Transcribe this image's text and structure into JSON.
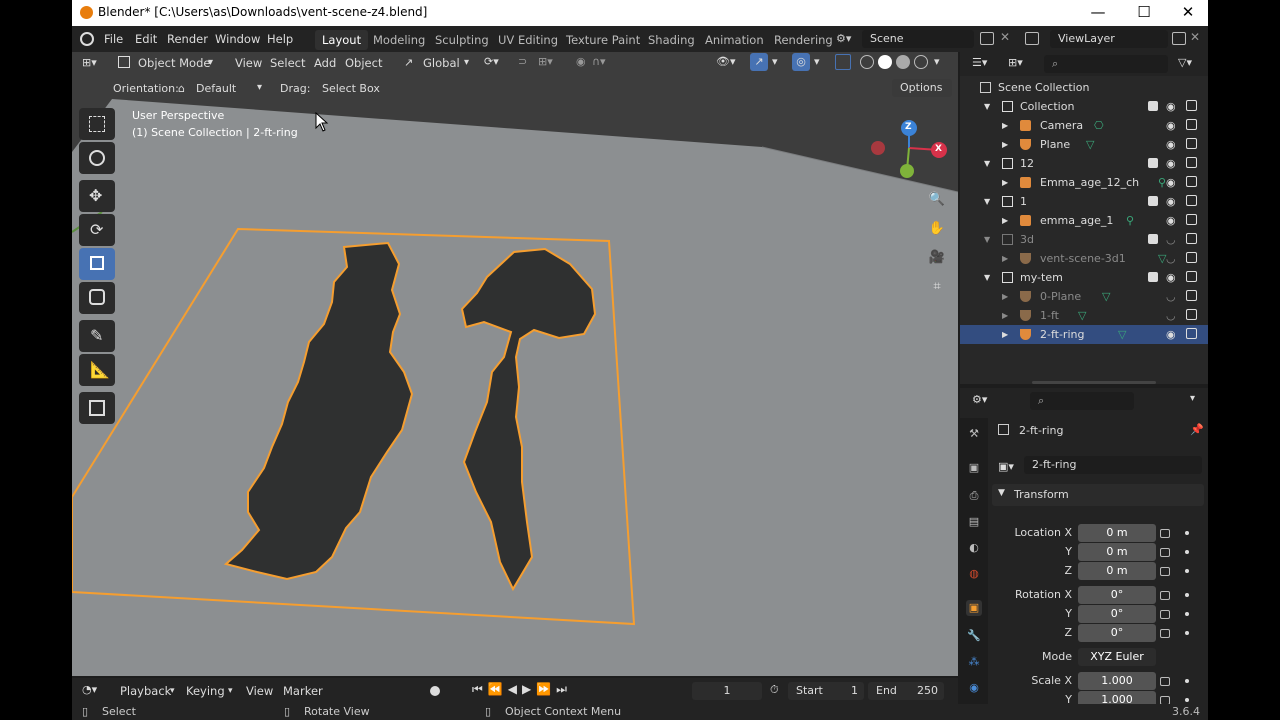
{
  "window": {
    "title": "Blender* [C:\\Users\\as\\Downloads\\vent-scene-z4.blend]",
    "minimize": "—",
    "maximize": "☐",
    "close": "✕"
  },
  "menus": [
    "File",
    "Edit",
    "Render",
    "Window",
    "Help"
  ],
  "workspaces": [
    "Layout",
    "Modeling",
    "Sculpting",
    "UV Editing",
    "Texture Paint",
    "Shading",
    "Animation",
    "Rendering"
  ],
  "scene": "Scene",
  "view_layer": "ViewLayer",
  "viewport_header": {
    "mode": "Object Mode",
    "view": "View",
    "select": "Select",
    "add": "Add",
    "object": "Object",
    "transform": "Global"
  },
  "tool_header": {
    "orientation_label": "Orientation:",
    "orientation": "Default",
    "drag_label": "Drag:",
    "drag": "Select Box",
    "options": "Options"
  },
  "viewport_info": {
    "line1": "User Perspective",
    "line2": "(1) Scene Collection | 2-ft-ring"
  },
  "gizmo": {
    "z": "Z",
    "x": "X"
  },
  "outliner": {
    "root": "Scene Collection",
    "rows": [
      {
        "label": "Collection",
        "kind": "collection",
        "depth": 0,
        "dim": false,
        "sel": false
      },
      {
        "label": "Camera",
        "kind": "camera",
        "depth": 1,
        "dim": false,
        "sel": false
      },
      {
        "label": "Plane",
        "kind": "mesh",
        "depth": 1,
        "dim": false,
        "sel": false
      },
      {
        "label": "12",
        "kind": "collection",
        "depth": 0,
        "dim": false,
        "sel": false
      },
      {
        "label": "Emma_age_12_ch",
        "kind": "armature",
        "depth": 1,
        "dim": false,
        "sel": false
      },
      {
        "label": "1",
        "kind": "collection",
        "depth": 0,
        "dim": false,
        "sel": false
      },
      {
        "label": "emma_age_1",
        "kind": "armature",
        "depth": 1,
        "dim": false,
        "sel": false
      },
      {
        "label": "3d",
        "kind": "collection",
        "depth": 0,
        "dim": true,
        "sel": false
      },
      {
        "label": "vent-scene-3d1",
        "kind": "mesh",
        "depth": 1,
        "dim": true,
        "sel": false
      },
      {
        "label": "my-tem",
        "kind": "collection",
        "depth": 0,
        "dim": false,
        "sel": false
      },
      {
        "label": "0-Plane",
        "kind": "mesh",
        "depth": 1,
        "dim": true,
        "sel": false
      },
      {
        "label": "1-ft",
        "kind": "mesh",
        "depth": 1,
        "dim": true,
        "sel": false
      },
      {
        "label": "2-ft-ring",
        "kind": "mesh",
        "depth": 1,
        "dim": false,
        "sel": true
      }
    ]
  },
  "properties": {
    "object_name": "2-ft-ring",
    "data_name": "2-ft-ring",
    "panel": "Transform",
    "rows": [
      {
        "label": "Location X",
        "value": "0 m"
      },
      {
        "label": "Y",
        "value": "0 m"
      },
      {
        "label": "Z",
        "value": "0 m"
      },
      {
        "label": "Rotation X",
        "value": "0°"
      },
      {
        "label": "Y",
        "value": "0°"
      },
      {
        "label": "Z",
        "value": "0°"
      },
      {
        "label": "Mode",
        "value": "XYZ Euler"
      },
      {
        "label": "Scale X",
        "value": "1.000"
      },
      {
        "label": "Y",
        "value": "1.000"
      }
    ]
  },
  "timeline": {
    "playback": "Playback",
    "keying": "Keying",
    "view": "View",
    "marker": "Marker",
    "frame": "1",
    "start_label": "Start",
    "start": "1",
    "end_label": "End",
    "end": "250"
  },
  "status": {
    "select": "Select",
    "rotate": "Rotate View",
    "context": "Object Context Menu",
    "version": "3.6.4"
  },
  "colors": {
    "accent": "#4772b3",
    "selection_outline": "#f59e30",
    "active_row": "#334d80"
  }
}
